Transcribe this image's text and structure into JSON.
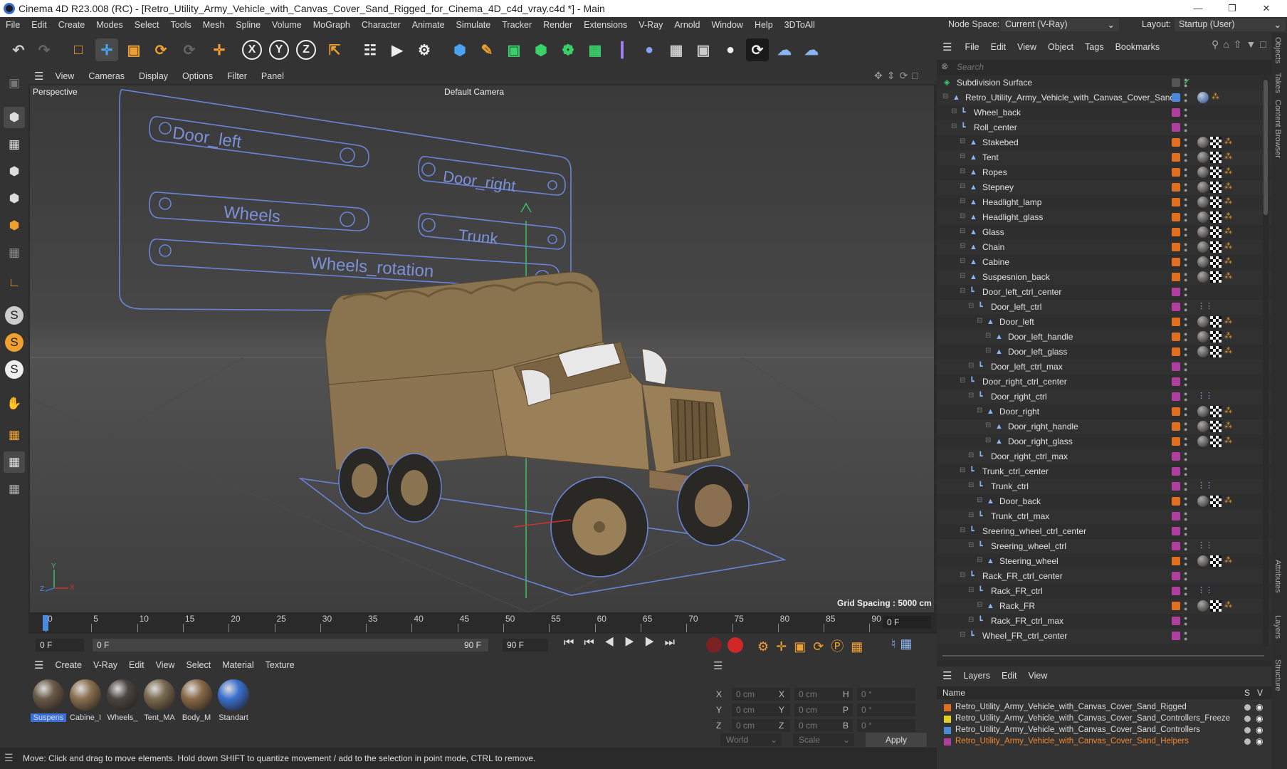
{
  "title": "Cinema 4D R23.008 (RC) - [Retro_Utility_Army_Vehicle_with_Canvas_Cover_Sand_Rigged_for_Cinema_4D_c4d_vray.c4d *] - Main",
  "menu": [
    "File",
    "Edit",
    "Create",
    "Modes",
    "Select",
    "Tools",
    "Mesh",
    "Spline",
    "Volume",
    "MoGraph",
    "Character",
    "Animate",
    "Simulate",
    "Tracker",
    "Render",
    "Extensions",
    "V-Ray",
    "Arnold",
    "Window",
    "Help",
    "3DToAll"
  ],
  "node_space": {
    "label": "Node Space:",
    "value": "Current (V-Ray)"
  },
  "layout": {
    "label": "Layout:",
    "value": "Startup (User)"
  },
  "viewport_menu": [
    "View",
    "Cameras",
    "Display",
    "Options",
    "Filter",
    "Panel"
  ],
  "viewport": {
    "name": "Perspective",
    "camera": "Default Camera",
    "grid": "Grid Spacing : 5000 cm",
    "axis_x": "X",
    "axis_y": "Y",
    "axis_z": "Z"
  },
  "rig_labels": [
    "Door_left",
    "Door_right",
    "Wheels",
    "Trunk",
    "Wheels_rotation"
  ],
  "timeline": {
    "ticks": [
      "0",
      "5",
      "10",
      "15",
      "20",
      "25",
      "30",
      "35",
      "40",
      "45",
      "50",
      "55",
      "60",
      "65",
      "70",
      "75",
      "80",
      "85",
      "90"
    ],
    "frame": "0 F"
  },
  "transport": {
    "start": "0 F",
    "range_start": "0 F",
    "range_end": "90 F",
    "end": "90 F"
  },
  "mat_menu": [
    "Create",
    "V-Ray",
    "Edit",
    "View",
    "Select",
    "Material",
    "Texture"
  ],
  "materials": [
    {
      "name": "Suspens",
      "color": "#6a5a48"
    },
    {
      "name": "Cabine_I",
      "color": "#8a7050"
    },
    {
      "name": "Wheels_",
      "color": "#4a4540"
    },
    {
      "name": "Tent_MA",
      "color": "#7a6a50"
    },
    {
      "name": "Body_M",
      "color": "#8a6a48"
    },
    {
      "name": "Standart",
      "color": "#3a70d0"
    }
  ],
  "coords": {
    "rows": [
      [
        "X",
        "0 cm",
        "X",
        "0 cm",
        "H",
        "0 °"
      ],
      [
        "Y",
        "0 cm",
        "Y",
        "0 cm",
        "P",
        "0 °"
      ],
      [
        "Z",
        "0 cm",
        "Z",
        "0 cm",
        "B",
        "0 °"
      ]
    ],
    "world": "World",
    "scale": "Scale",
    "apply": "Apply"
  },
  "status": "Move: Click and drag to move elements. Hold down SHIFT to quantize movement / add to the selection in point mode, CTRL to remove.",
  "obj_menu": [
    "File",
    "Edit",
    "View",
    "Object",
    "Tags",
    "Bookmarks"
  ],
  "search_placeholder": "Search",
  "objects": [
    {
      "name": "Subdivision Surface",
      "indent": 0,
      "icon": "subd",
      "layer": "",
      "tags": "check"
    },
    {
      "name": "Retro_Utility_Army_Vehicle_with_Canvas_Cover_Sand",
      "indent": 1,
      "icon": "mesh",
      "layer": "#4a8ad8",
      "tags": "root"
    },
    {
      "name": "Wheel_back",
      "indent": 2,
      "icon": "null",
      "layer": "#b040a0",
      "tags": ""
    },
    {
      "name": "Roll_center",
      "indent": 2,
      "icon": "null",
      "layer": "#b040a0",
      "tags": ""
    },
    {
      "name": "Stakebed",
      "indent": 3,
      "icon": "mesh",
      "layer": "#e07020",
      "tags": "mat"
    },
    {
      "name": "Tent",
      "indent": 3,
      "icon": "mesh",
      "layer": "#e07020",
      "tags": "mat"
    },
    {
      "name": "Ropes",
      "indent": 3,
      "icon": "mesh",
      "layer": "#e07020",
      "tags": "mat"
    },
    {
      "name": "Stepney",
      "indent": 3,
      "icon": "mesh",
      "layer": "#e07020",
      "tags": "mat"
    },
    {
      "name": "Headlight_lamp",
      "indent": 3,
      "icon": "mesh",
      "layer": "#e07020",
      "tags": "mat"
    },
    {
      "name": "Headlight_glass",
      "indent": 3,
      "icon": "mesh",
      "layer": "#e07020",
      "tags": "mat"
    },
    {
      "name": "Glass",
      "indent": 3,
      "icon": "mesh",
      "layer": "#e07020",
      "tags": "mat"
    },
    {
      "name": "Chain",
      "indent": 3,
      "icon": "mesh",
      "layer": "#e07020",
      "tags": "mat"
    },
    {
      "name": "Cabine",
      "indent": 3,
      "icon": "mesh",
      "layer": "#e07020",
      "tags": "mat"
    },
    {
      "name": "Suspesnion_back",
      "indent": 3,
      "icon": "mesh",
      "layer": "#e07020",
      "tags": "mat"
    },
    {
      "name": "Door_left_ctrl_center",
      "indent": 3,
      "icon": "null",
      "layer": "#b040a0",
      "tags": ""
    },
    {
      "name": "Door_left_ctrl",
      "indent": 4,
      "icon": "null",
      "layer": "#b040a0",
      "tags": "xp"
    },
    {
      "name": "Door_left",
      "indent": 5,
      "icon": "mesh",
      "layer": "#e07020",
      "tags": "mat"
    },
    {
      "name": "Door_left_handle",
      "indent": 6,
      "icon": "mesh",
      "layer": "#e07020",
      "tags": "mat"
    },
    {
      "name": "Door_left_glass",
      "indent": 6,
      "icon": "mesh",
      "layer": "#e07020",
      "tags": "mat"
    },
    {
      "name": "Door_left_ctrl_max",
      "indent": 4,
      "icon": "null",
      "layer": "#b040a0",
      "tags": ""
    },
    {
      "name": "Door_right_ctrl_center",
      "indent": 3,
      "icon": "null",
      "layer": "#b040a0",
      "tags": ""
    },
    {
      "name": "Door_right_ctrl",
      "indent": 4,
      "icon": "null",
      "layer": "#b040a0",
      "tags": "xp"
    },
    {
      "name": "Door_right",
      "indent": 5,
      "icon": "mesh",
      "layer": "#e07020",
      "tags": "mat"
    },
    {
      "name": "Door_right_handle",
      "indent": 6,
      "icon": "mesh",
      "layer": "#e07020",
      "tags": "mat"
    },
    {
      "name": "Door_right_glass",
      "indent": 6,
      "icon": "mesh",
      "layer": "#e07020",
      "tags": "mat"
    },
    {
      "name": "Door_right_ctrl_max",
      "indent": 4,
      "icon": "null",
      "layer": "#b040a0",
      "tags": ""
    },
    {
      "name": "Trunk_ctrl_center",
      "indent": 3,
      "icon": "null",
      "layer": "#b040a0",
      "tags": ""
    },
    {
      "name": "Trunk_ctrl",
      "indent": 4,
      "icon": "null",
      "layer": "#b040a0",
      "tags": "xp"
    },
    {
      "name": "Door_back",
      "indent": 5,
      "icon": "mesh",
      "layer": "#e07020",
      "tags": "mat"
    },
    {
      "name": "Trunk_ctrl_max",
      "indent": 4,
      "icon": "null",
      "layer": "#b040a0",
      "tags": ""
    },
    {
      "name": "Sreering_wheel_ctrl_center",
      "indent": 3,
      "icon": "null",
      "layer": "#b040a0",
      "tags": ""
    },
    {
      "name": "Sreering_wheel_ctrl",
      "indent": 4,
      "icon": "null",
      "layer": "#b040a0",
      "tags": "xp"
    },
    {
      "name": "Steering_wheel",
      "indent": 5,
      "icon": "mesh",
      "layer": "#e07020",
      "tags": "mat"
    },
    {
      "name": "Rack_FR_ctrl_center",
      "indent": 3,
      "icon": "null",
      "layer": "#b040a0",
      "tags": ""
    },
    {
      "name": "Rack_FR_ctrl",
      "indent": 4,
      "icon": "null",
      "layer": "#b040a0",
      "tags": "xp"
    },
    {
      "name": "Rack_FR",
      "indent": 5,
      "icon": "mesh",
      "layer": "#e07020",
      "tags": "mat"
    },
    {
      "name": "Rack_FR_ctrl_max",
      "indent": 4,
      "icon": "null",
      "layer": "#b040a0",
      "tags": ""
    },
    {
      "name": "Wheel_FR_ctrl_center",
      "indent": 3,
      "icon": "null",
      "layer": "#b040a0",
      "tags": ""
    }
  ],
  "layers_menu": [
    "Layers",
    "Edit",
    "View"
  ],
  "layers_header": {
    "name": "Name",
    "s": "S",
    "v": "V"
  },
  "layers": [
    {
      "name": "Retro_Utility_Army_Vehicle_with_Canvas_Cover_Sand_Rigged",
      "color": "#e07020",
      "text": "#dcdcdc"
    },
    {
      "name": "Retro_Utility_Army_Vehicle_with_Canvas_Cover_Sand_Controllers_Freeze",
      "color": "#e0d020",
      "text": "#dcdcdc"
    },
    {
      "name": "Retro_Utility_Army_Vehicle_with_Canvas_Cover_Sand_Controllers",
      "color": "#4a8ad8",
      "text": "#dcdcdc"
    },
    {
      "name": "Retro_Utility_Army_Vehicle_with_Canvas_Cover_Sand_Helpers",
      "color": "#b040a0",
      "text": "#f08a30"
    }
  ],
  "side_tabs": [
    "Objects",
    "Takes",
    "Content Browser",
    "Attributes",
    "Layers",
    "Structure"
  ]
}
